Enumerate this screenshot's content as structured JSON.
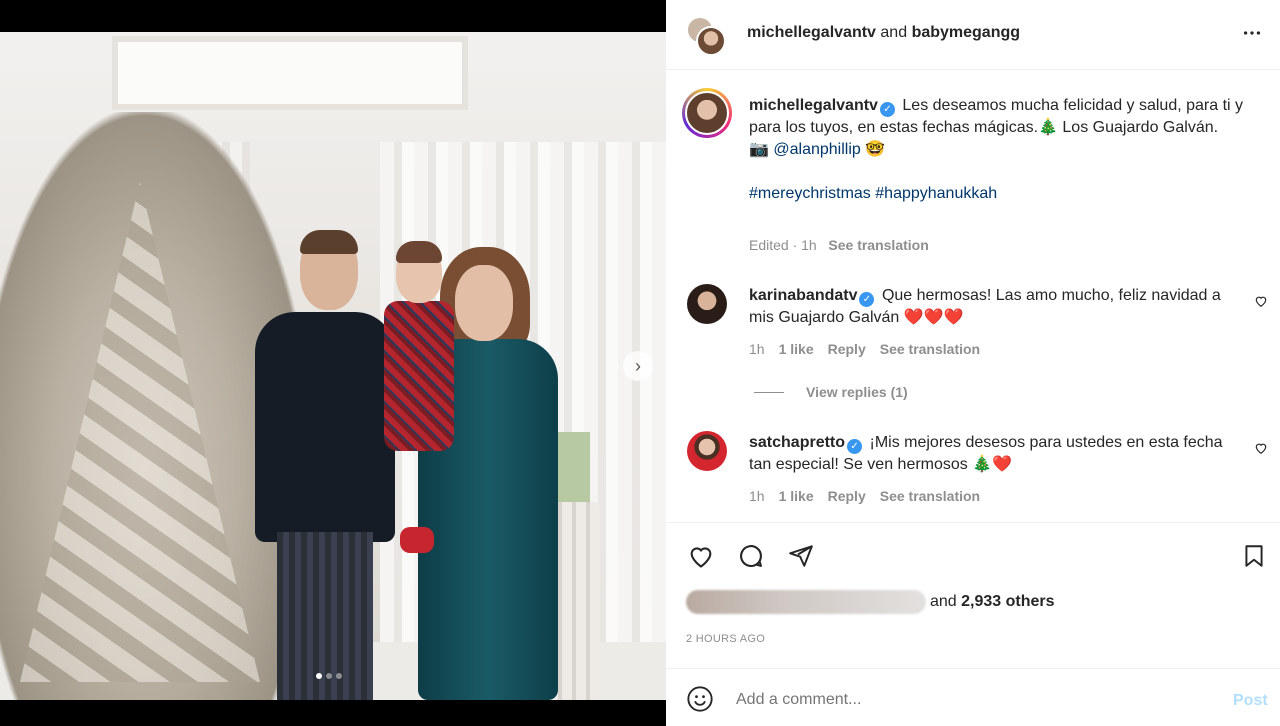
{
  "header": {
    "user1": "michellegalvantv",
    "joiner": "and",
    "user2": "babymegangg",
    "more_icon": "more-horizontal-icon"
  },
  "caption": {
    "username": "michellegalvantv",
    "text_line1": "Les deseamos mucha felicidad y salud, para ti y para los tuyos, en estas fechas mágicas.🎄 Los Guajardo Galván.",
    "camera": "📷",
    "photo_credit": "@alanphillip",
    "credit_emoji": "🤓",
    "hashtag1": "#mereychristmas",
    "hashtag2": "#happyhanukkah",
    "edited": "Edited · 1h",
    "see_translation": "See translation"
  },
  "comments": [
    {
      "username": "karinabandatv",
      "text": "Que hermosas! Las amo mucho, feliz navidad a mis Guajardo Galván ❤️❤️❤️",
      "time": "1h",
      "likes": "1 like",
      "reply": "Reply",
      "translate": "See translation"
    },
    {
      "username": "satchapretto",
      "text": "¡Mis mejores desesos para ustedes en esta fecha tan especial! Se ven hermosos 🎄❤️",
      "time": "1h",
      "likes": "1 like",
      "reply": "Reply",
      "translate": "See translation"
    }
  ],
  "view_replies": "View replies (1)",
  "likes": {
    "suffix": "and",
    "others": "2,933 others"
  },
  "timestamp": "2 HOURS AGO",
  "add_comment": {
    "placeholder": "Add a comment...",
    "post": "Post"
  },
  "carousel": {
    "next": "›",
    "total_slides": 3,
    "active_slide": 1
  },
  "colors": {
    "link": "#00376b",
    "verified": "#3897f0",
    "muted": "#8e8e8e",
    "post_disabled": "#b2dffc"
  }
}
